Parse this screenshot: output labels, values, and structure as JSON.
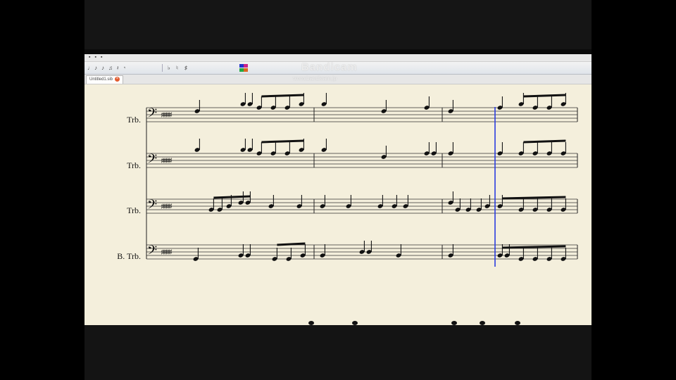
{
  "app": {
    "watermark": "Bandicam",
    "watermark_url": "www.bandicam.jp",
    "tab_label": "Untitled1.sib"
  },
  "toolbar": {
    "buttons": [
      "♩",
      "♪",
      "♪",
      "♫",
      "𝄽",
      "𝄾",
      "♭",
      "♮",
      "♯"
    ],
    "colors": [
      "#2233cc",
      "#cc2288",
      "#22aa44",
      "#dd6622"
    ]
  },
  "score": {
    "instruments": [
      {
        "name": "Trb."
      },
      {
        "name": "Trb."
      },
      {
        "name": "Trb."
      },
      {
        "name": "B. Trb."
      }
    ],
    "clef": "𝄢",
    "key_signature": "♯♯♯♯♯♯",
    "playback_cursor_color": "#2a3ce0"
  }
}
